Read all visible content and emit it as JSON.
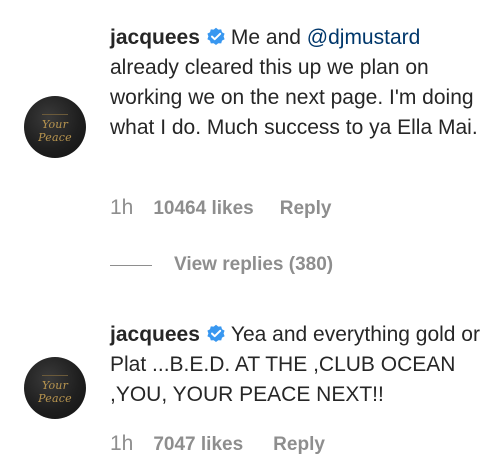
{
  "colors": {
    "text": "#262626",
    "muted": "#8e8e8e",
    "mention": "#00376b",
    "verified": "#3897f0",
    "avatar_bg": "#1f1f1f",
    "avatar_script": "#b8954f"
  },
  "comments": [
    {
      "username": "jacquees",
      "verified_icon": "verified-badge-icon",
      "avatar_icon": "your-peace-avatar",
      "avatar_text": "Your Peace",
      "text_before": "Me and ",
      "mention": "@djmustard",
      "text_after": "already cleared this up we plan on working we on the next page. I'm doing what I do. Much success to ya Ella Mai.",
      "time": "1h",
      "likes": "10464 likes",
      "reply_label": "Reply"
    },
    {
      "username": "jacquees",
      "verified_icon": "verified-badge-icon",
      "avatar_icon": "your-peace-avatar",
      "avatar_text": "Your Peace",
      "text": "Yea and everything gold or Plat ...B.E.D. AT THE ,CLUB OCEAN ,YOU, YOUR PEACE NEXT!!",
      "time": "1h",
      "likes": "7047 likes",
      "reply_label": "Reply"
    }
  ],
  "view_replies": {
    "label": "View replies (380)"
  }
}
